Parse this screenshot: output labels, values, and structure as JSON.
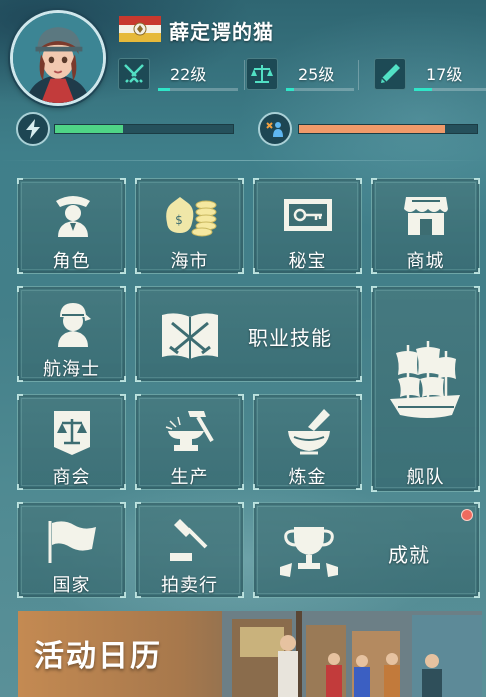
{
  "player": {
    "name": "薛定谔的猫"
  },
  "skills": [
    {
      "icon": "crossed-swords-icon",
      "level": "22级",
      "progress": 0.15
    },
    {
      "icon": "scales-icon",
      "level": "25级",
      "progress": 0.12
    },
    {
      "icon": "pen-icon",
      "level": "17级",
      "progress": 0.25
    }
  ],
  "energy": {
    "icon": "lightning-icon",
    "progress": 0.38,
    "color": "#4fd486"
  },
  "vitality": {
    "icon": "crew-icon",
    "progress": 0.82,
    "color": "#f09a6a"
  },
  "menu": {
    "role": "角色",
    "market": "海市",
    "treasure": "秘宝",
    "mall": "商城",
    "navigator": "航海士",
    "job_skill": "职业技能",
    "fleet": "舰队",
    "guild": "商会",
    "production": "生产",
    "alchemy": "炼金",
    "nation": "国家",
    "auction": "拍卖行",
    "achievement": "成就"
  },
  "banner": {
    "title": "活动日历"
  },
  "colors": {
    "accent": "#2fe6c8",
    "notification": "#f06a5e"
  }
}
